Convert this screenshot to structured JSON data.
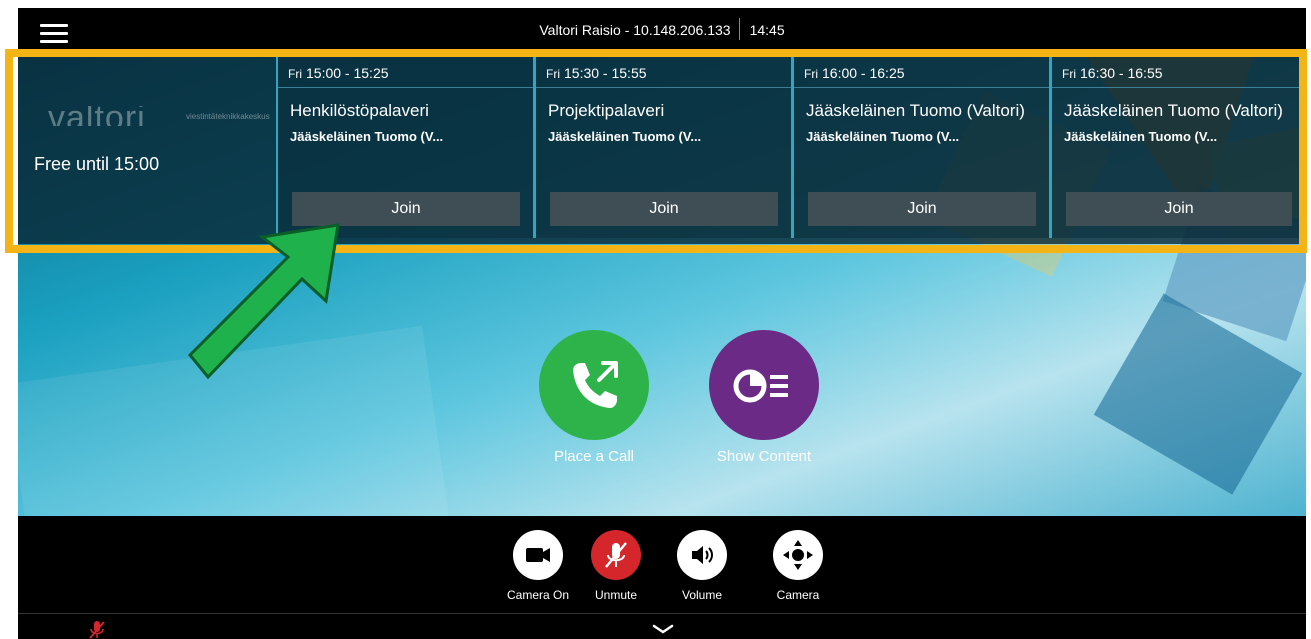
{
  "topbar": {
    "device_name": "Valtori Raisio - 10.148.206.133",
    "time": "14:45"
  },
  "calendar": {
    "logo_text": "valtori",
    "logo_sub": "viestintäteknikkakeskus",
    "free_label": "Free until 15:00",
    "meetings": [
      {
        "day": "Fri",
        "time": "15:00 - 15:25",
        "title": "Henkilöstöpalaveri",
        "organizer": "Jääskeläinen Tuomo (V...",
        "join_label": "Join"
      },
      {
        "day": "Fri",
        "time": "15:30 - 15:55",
        "title": "Projektipalaveri",
        "organizer": "Jääskeläinen Tuomo (V...",
        "join_label": "Join"
      },
      {
        "day": "Fri",
        "time": "16:00 - 16:25",
        "title": "Jääskeläinen Tuomo (Valtori)",
        "organizer": "Jääskeläinen Tuomo (V...",
        "join_label": "Join"
      },
      {
        "day": "Fri",
        "time": "16:30 - 16:55",
        "title": "Jääskeläinen Tuomo (Valtori)",
        "organizer": "Jääskeläinen Tuomo (V...",
        "join_label": "Join"
      }
    ]
  },
  "actions": {
    "place_call": {
      "label": "Place a Call",
      "icon": "phone-outgoing-icon",
      "color": "#2db34a"
    },
    "show_content": {
      "label": "Show Content",
      "icon": "content-share-icon",
      "color": "#6b2a85"
    }
  },
  "controls": {
    "camera_on": {
      "label": "Camera On",
      "icon": "video-camera-icon"
    },
    "unmute": {
      "label": "Unmute",
      "icon": "mic-muted-icon",
      "color": "#d5262c"
    },
    "volume": {
      "label": "Volume",
      "icon": "speaker-icon"
    },
    "camera": {
      "label": "Camera",
      "icon": "camera-control-icon"
    }
  },
  "colors": {
    "highlight": "#f5b416",
    "arrow": "#1fb14c",
    "card_border": "#2ea7c2"
  }
}
